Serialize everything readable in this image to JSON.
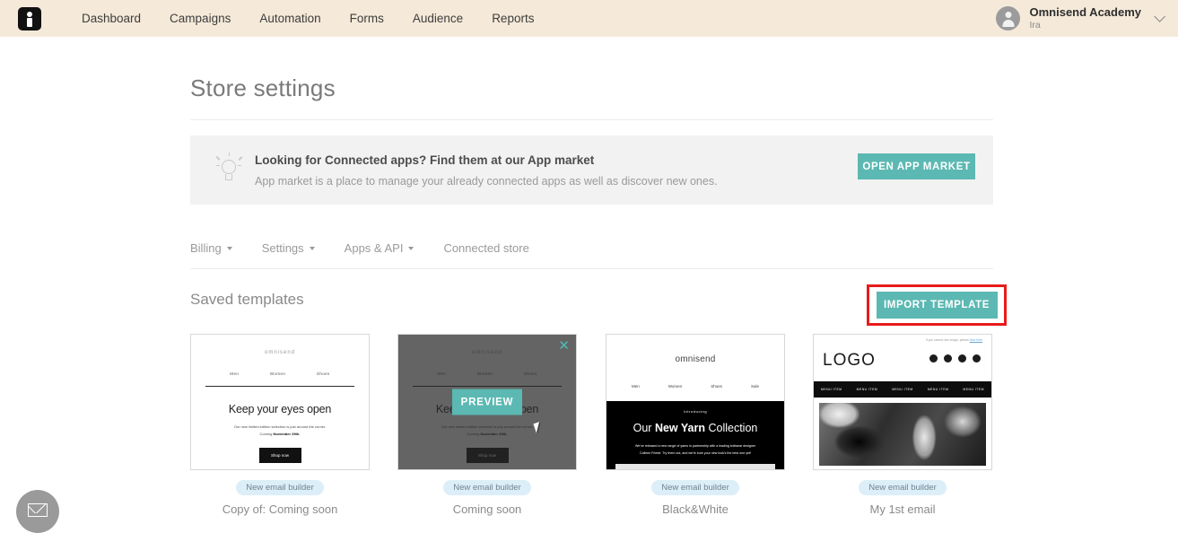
{
  "topbar": {
    "logo_icon": "omnisend-logo-icon",
    "nav": [
      {
        "label": "Dashboard"
      },
      {
        "label": "Campaigns"
      },
      {
        "label": "Automation"
      },
      {
        "label": "Forms"
      },
      {
        "label": "Audience"
      },
      {
        "label": "Reports"
      }
    ],
    "account": {
      "name": "Omnisend Academy",
      "user": "Ira",
      "avatar_icon": "user-avatar-icon",
      "chevron_icon": "chevron-down-icon"
    }
  },
  "page": {
    "title": "Store settings"
  },
  "banner": {
    "icon": "lightbulb-icon",
    "title": "Looking for Connected apps? Find them at our App market",
    "subtitle": "App market is a place to manage your already connected apps as well as discover new ones.",
    "button_label": "OPEN APP MARKET"
  },
  "tabs": [
    {
      "label": "Billing",
      "has_caret": true
    },
    {
      "label": "Settings",
      "has_caret": true
    },
    {
      "label": "Apps & API",
      "has_caret": true
    },
    {
      "label": "Connected store",
      "has_caret": false
    }
  ],
  "templates_section": {
    "heading": "Saved templates",
    "import_button_label": "IMPORT TEMPLATE",
    "highlight_color": "#E81B1B"
  },
  "overlay": {
    "preview_label": "PREVIEW",
    "close_icon": "close-x-icon",
    "cursor_icon": "mouse-cursor-icon"
  },
  "mock_email_a": {
    "brand": "omnisend",
    "nav": [
      "Men",
      "Women",
      "Shoes"
    ],
    "headline": "Keep your eyes open",
    "line1": "Our new limited edition selection is just around the corner.",
    "line2_pre": "Coming ",
    "line2_bold": "November 29th.",
    "cta": "Shop now"
  },
  "mock_email_c": {
    "brand": "omnisend",
    "nav": [
      "Men",
      "Women",
      "Shoes",
      "Sale"
    ],
    "intro": "Introducing",
    "head_pre": "Our ",
    "head_bold": "New Yarn",
    "head_post": " Collection",
    "body1": "We've released a new range of yarns in partnership with a leading knitwear designer",
    "body2": "Colleen Friede. Try them out, and we're sure your new look's the best one yet!"
  },
  "mock_email_d": {
    "preheader": "If you cannot see image, please ",
    "preheader_link": "click here",
    "logo": "LOGO",
    "menu": [
      "MENU ITEM",
      "MENU ITEM",
      "MENU ITEM",
      "MENU ITEM",
      "MENU ITEM"
    ],
    "social_icons": [
      "facebook-icon",
      "twitter-icon",
      "instagram-icon",
      "youtube-icon"
    ]
  },
  "cards": [
    {
      "badge": "New email builder",
      "caption": "Copy of: Coming soon"
    },
    {
      "badge": "New email builder",
      "caption": "Coming soon"
    },
    {
      "badge": "New email builder",
      "caption": "Black&White"
    },
    {
      "badge": "New email builder",
      "caption": "My 1st email"
    }
  ],
  "fab": {
    "icon": "envelope-icon"
  },
  "colors": {
    "topbar_bg": "#F5E9D9",
    "teal": "#5CB8B2",
    "banner_bg": "#F2F2F2",
    "badge_bg": "#DCEEF8",
    "highlight": "#E81B1B"
  }
}
